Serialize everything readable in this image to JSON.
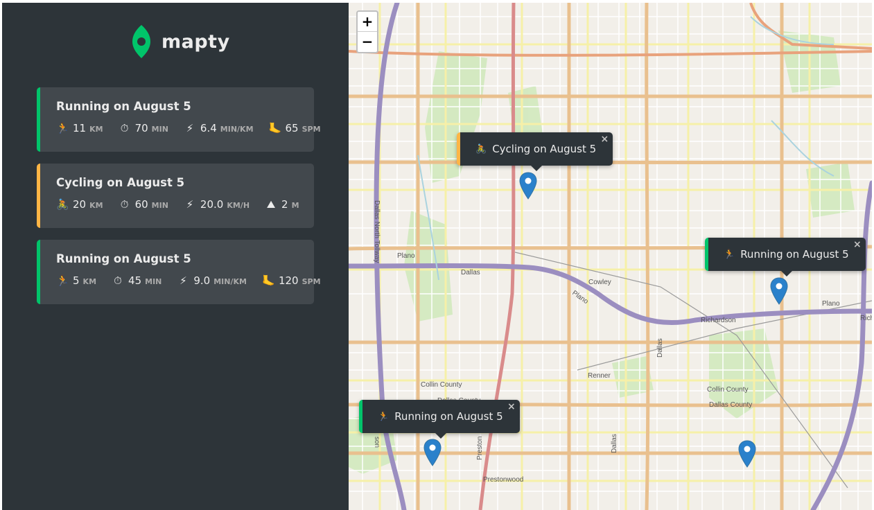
{
  "app": {
    "name": "mapty"
  },
  "workouts": [
    {
      "type": "running",
      "title": "Running on August 5",
      "details": [
        {
          "icon": "🏃",
          "value": "11",
          "unit": "km"
        },
        {
          "icon": "⏱",
          "value": "70",
          "unit": "min"
        },
        {
          "icon": "⚡",
          "value": "6.4",
          "unit": "min/km"
        },
        {
          "icon": "🦶",
          "value": "65",
          "unit": "spm"
        }
      ]
    },
    {
      "type": "cycling",
      "title": "Cycling on August 5",
      "details": [
        {
          "icon": "🚴",
          "value": "20",
          "unit": "km"
        },
        {
          "icon": "⏱",
          "value": "60",
          "unit": "min"
        },
        {
          "icon": "⚡",
          "value": "20.0",
          "unit": "km/h"
        },
        {
          "icon": "⛰",
          "value": "2",
          "unit": "m"
        }
      ]
    },
    {
      "type": "running",
      "title": "Running on August 5",
      "details": [
        {
          "icon": "🏃",
          "value": "5",
          "unit": "km"
        },
        {
          "icon": "⏱",
          "value": "45",
          "unit": "min"
        },
        {
          "icon": "⚡",
          "value": "9.0",
          "unit": "min/km"
        },
        {
          "icon": "🦶",
          "value": "120",
          "unit": "spm"
        }
      ]
    }
  ],
  "map": {
    "zoom_in": "+",
    "zoom_out": "−",
    "close_symbol": "×",
    "popups": [
      {
        "type": "cycling",
        "icon": "🚴",
        "text": "Cycling on August 5"
      },
      {
        "type": "running",
        "icon": "🏃",
        "text": "Running on August 5"
      },
      {
        "type": "running",
        "icon": "🏃",
        "text": "Running on August 5"
      }
    ],
    "labels": {
      "dallas_north_tollway": "Dallas North Tollway",
      "plano_1": "Plano",
      "dallas_1": "Dallas",
      "cowley": "Cowley",
      "plano_2": "Plano",
      "richardson": "Richardson",
      "plano_3": "Plano",
      "rich": "Rich",
      "renner": "Renner",
      "dallas_2": "Dallas",
      "collin_county_1": "Collin County",
      "dallas_county_1": "Dallas County",
      "collin_county_2": "Collin County",
      "dallas_county_2": "Dallas County",
      "prestonwood": "Prestonwood",
      "preston": "Preston",
      "dallas_3": "Dallas",
      "dallas_4": "Dallas",
      "son": "son"
    }
  },
  "colors": {
    "running": "#00c46a",
    "cycling": "#ffb545",
    "sidebar_bg": "#2d3439",
    "card_bg": "#42484d",
    "marker": "#2a81cb"
  }
}
